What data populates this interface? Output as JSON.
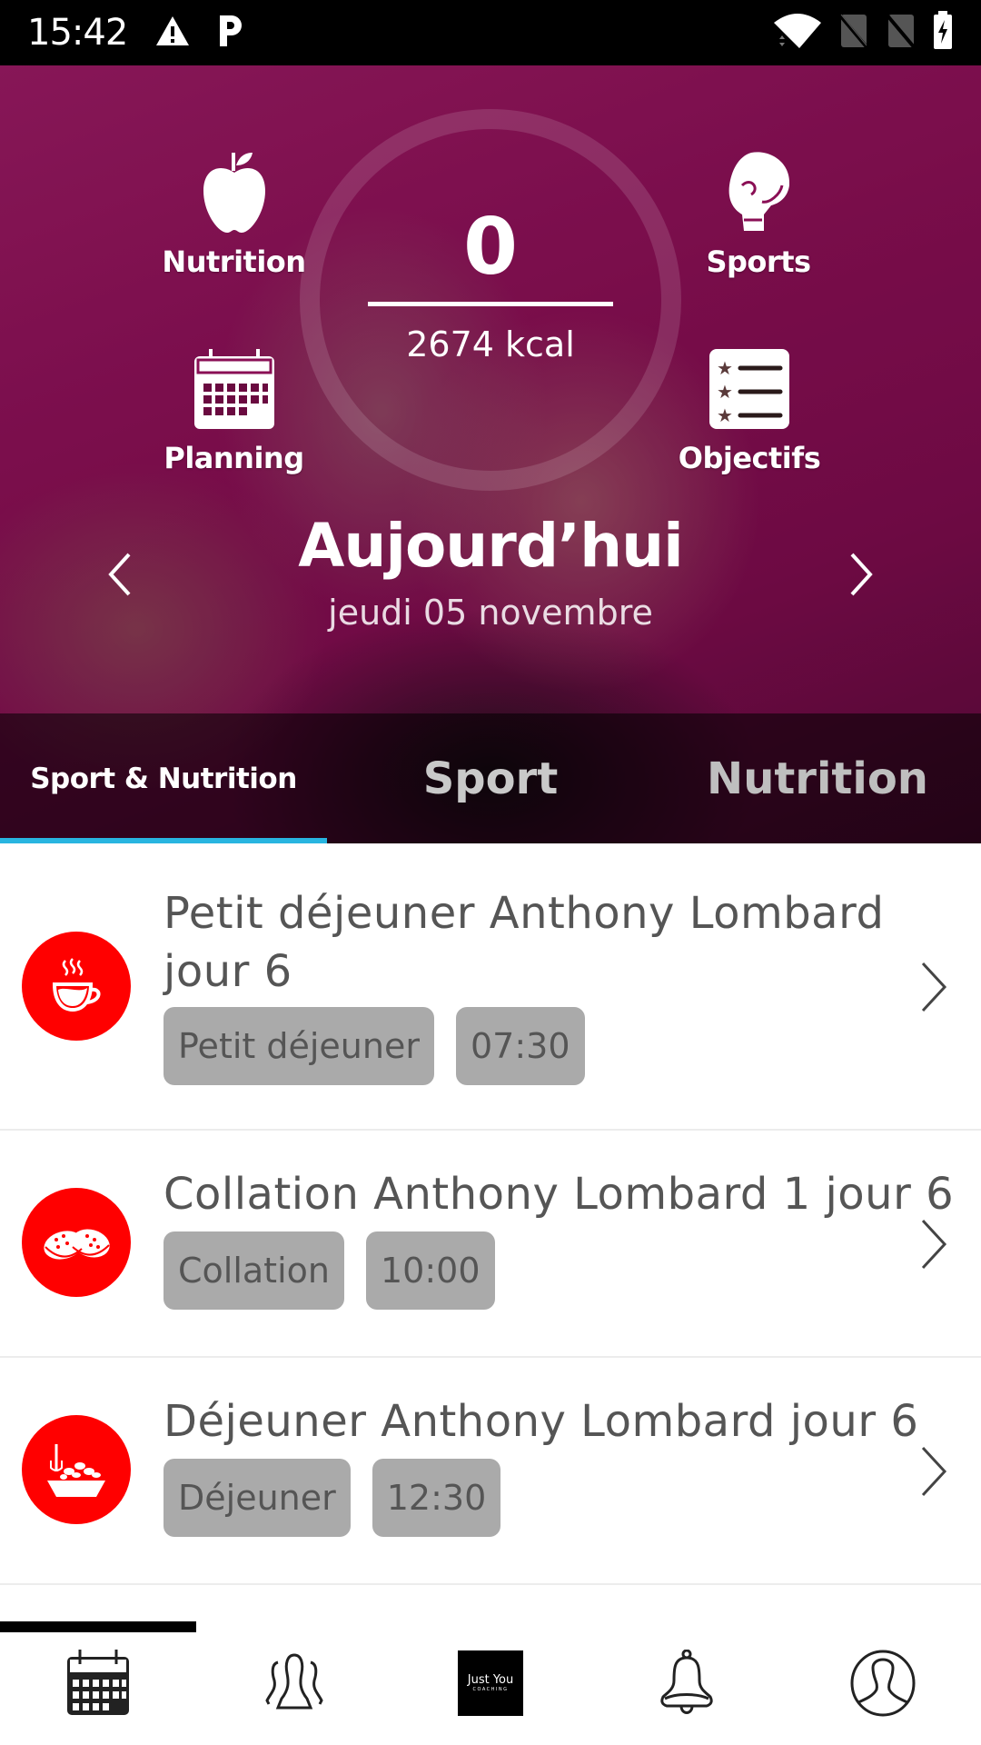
{
  "status_bar": {
    "time": "15:42",
    "left_icons": [
      "warning-icon",
      "parking-icon"
    ],
    "right_icons": [
      "wifi-icon",
      "no-sim-icon",
      "no-sim-icon",
      "battery-charging-icon"
    ]
  },
  "hero": {
    "kcal_consumed": "0",
    "kcal_target": "2674 kcal",
    "shortcuts": [
      {
        "label": "Nutrition",
        "icon": "apple-icon"
      },
      {
        "label": "Sports",
        "icon": "boxing-glove-icon"
      },
      {
        "label": "Planning",
        "icon": "calendar-icon"
      },
      {
        "label": "Objectifs",
        "icon": "star-list-icon"
      }
    ],
    "day_title": "Aujourd’hui",
    "day_date": "jeudi 05 novembre"
  },
  "tabs": [
    {
      "label": "Sport & Nutrition",
      "active": true
    },
    {
      "label": "Sport",
      "active": false
    },
    {
      "label": "Nutrition",
      "active": false
    }
  ],
  "meals": [
    {
      "title": "Petit déjeuner Anthony Lombard jour 6",
      "icon": "coffee-cup-icon",
      "category": "Petit déjeuner",
      "time": "07:30"
    },
    {
      "title": "Collation Anthony Lombard 1 jour 6",
      "icon": "cookies-icon",
      "category": "Collation",
      "time": "10:00"
    },
    {
      "title": "Déjeuner Anthony Lombard jour 6",
      "icon": "salad-bowl-icon",
      "category": "Déjeuner",
      "time": "12:30"
    }
  ],
  "bottom_nav": {
    "items": [
      "calendar-icon",
      "group-icon",
      "logo",
      "bell-icon",
      "profile-icon"
    ],
    "active_index": 0,
    "logo_text": "Just You",
    "logo_subtext": "COACHING"
  },
  "colors": {
    "accent_tab": "#28b5e0",
    "meal_icon_bg": "#ff0000",
    "tag_bg": "#aaaaaa"
  }
}
